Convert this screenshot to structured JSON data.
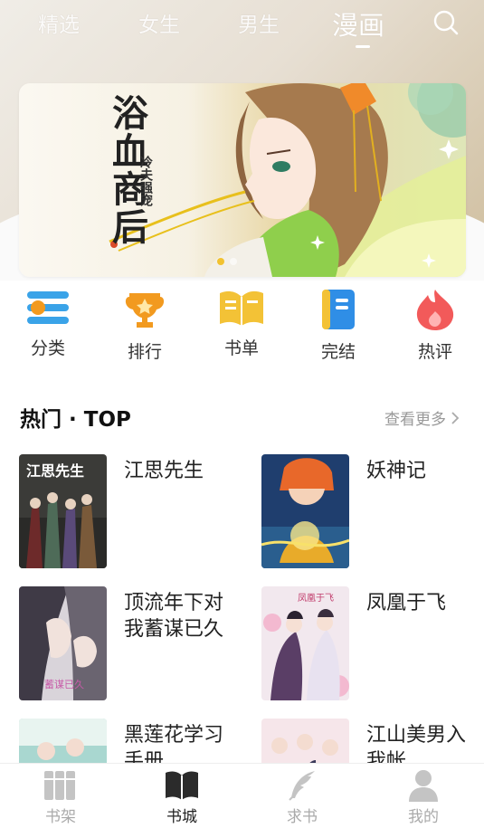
{
  "top_tabs": [
    {
      "label": "精选"
    },
    {
      "label": "女生"
    },
    {
      "label": "男生"
    },
    {
      "label": "漫画"
    }
  ],
  "active_tab": "漫画",
  "search_icon": "search-icon",
  "banner": {
    "title": "浴血商后",
    "subtitle": "冷夫强宠",
    "slide_count": 2,
    "active_slide": 1
  },
  "categories": [
    {
      "label": "分类",
      "icon": "list-icon",
      "color": "#3aa3e8"
    },
    {
      "label": "排行",
      "icon": "trophy-icon",
      "color": "#f29a1f"
    },
    {
      "label": "书单",
      "icon": "open-book-icon",
      "color": "#f3c236"
    },
    {
      "label": "完结",
      "icon": "notebook-icon",
      "color": "#2f8ee6"
    },
    {
      "label": "热评",
      "icon": "flame-icon",
      "color": "#f25a5a"
    }
  ],
  "section": {
    "title": "热门 · TOP",
    "more_label": "查看更多"
  },
  "books": [
    {
      "title": "江思先生"
    },
    {
      "title": "妖神记"
    },
    {
      "title": "顶流年下对我蓄谋已久"
    },
    {
      "title": "凤凰于飞"
    },
    {
      "title": "黑莲花学习手册"
    },
    {
      "title": "江山美男入我帐"
    }
  ],
  "bottom_nav": [
    {
      "label": "书架",
      "icon": "bookshelf-icon"
    },
    {
      "label": "书城",
      "icon": "book-city-icon"
    },
    {
      "label": "求书",
      "icon": "feather-icon"
    },
    {
      "label": "我的",
      "icon": "user-icon"
    }
  ],
  "active_bottom_tab": "书城"
}
